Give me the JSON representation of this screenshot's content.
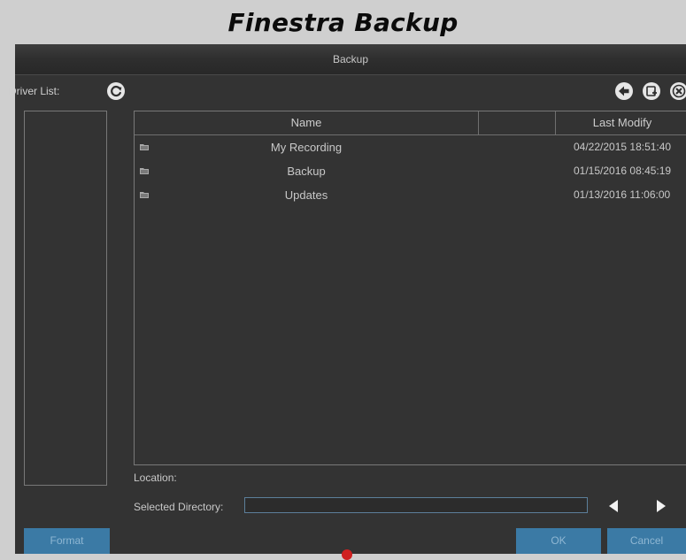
{
  "caption": "Finestra Backup",
  "window": {
    "title": "Backup"
  },
  "driver_list": {
    "label": "Driver List:"
  },
  "icons": {
    "refresh": "refresh-icon",
    "back": "back-arrow-icon",
    "new_folder": "new-folder-icon",
    "delete": "delete-icon",
    "folder": "folder-icon"
  },
  "table": {
    "headers": {
      "name": "Name",
      "blank": "",
      "last_modify": "Last Modify"
    },
    "rows": [
      {
        "name": "My Recording",
        "last_modify": "04/22/2015 18:51:40"
      },
      {
        "name": "Backup",
        "last_modify": "01/15/2016 08:45:19"
      },
      {
        "name": "Updates",
        "last_modify": "01/13/2016 11:06:00"
      }
    ]
  },
  "location": {
    "label": "Location:"
  },
  "selected_directory": {
    "label": "Selected Directory:",
    "value": ""
  },
  "buttons": {
    "format": "Format",
    "ok": "OK",
    "cancel": "Cancel"
  },
  "colors": {
    "window_bg": "#333333",
    "button_accent": "#3b7aa5",
    "input_border": "#5c7f9a"
  }
}
